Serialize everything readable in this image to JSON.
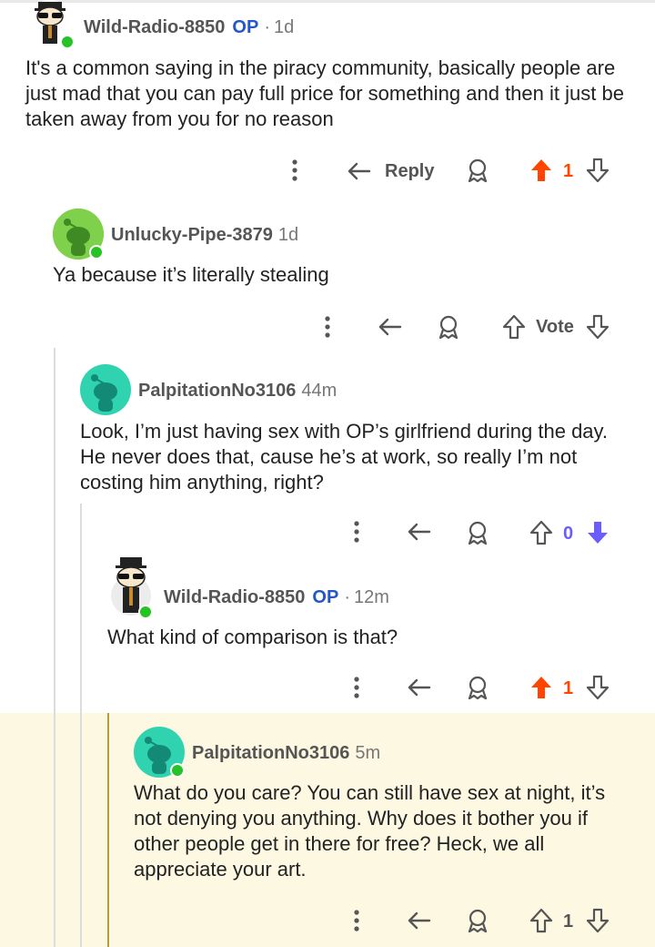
{
  "comments": [
    {
      "username": "Wild-Radio-8850",
      "op_badge": "OP",
      "separator": "·",
      "age": "1d",
      "text": "It's a common saying in the piracy community, basically people are just mad that you can pay full price for something and then it just be taken away from you for no reason",
      "reply_label": "Reply",
      "vote_count": "1",
      "vote_state": "upvoted"
    },
    {
      "username": "Unlucky-Pipe-3879",
      "age": "1d",
      "text": "Ya because it’s literally stealing",
      "vote_label": "Vote",
      "vote_state": "none"
    },
    {
      "username": "PalpitationNo3106",
      "age": "44m",
      "text": "Look, I’m just having sex with OP’s girlfriend during the day. He never does that, cause he’s at work, so really I’m not costing him anything, right?",
      "vote_count": "0",
      "vote_state": "downvoted"
    },
    {
      "username": "Wild-Radio-8850",
      "op_badge": "OP",
      "separator": "·",
      "age": "12m",
      "text": "What kind of comparison is that?",
      "vote_count": "1",
      "vote_state": "upvoted"
    },
    {
      "username": "PalpitationNo3106",
      "age": "5m",
      "text": "What do you care? You can still have sex at night, it’s not denying you anything. Why does it bother you if other people get in there for free? Heck, we all appreciate your art.",
      "vote_count": "1",
      "vote_state": "none",
      "highlighted": true
    }
  ],
  "colors": {
    "upvote": "#ff4500",
    "downvote": "#6a5cff",
    "op_badge": "#2456c8",
    "online_dot": "#26c226",
    "highlight_bg": "#fcf8e2",
    "avatar_green": "#7fd04a",
    "avatar_teal": "#2fd3b0"
  },
  "icons": [
    "more-icon",
    "reply-icon",
    "award-icon",
    "upvote-icon",
    "downvote-icon"
  ]
}
